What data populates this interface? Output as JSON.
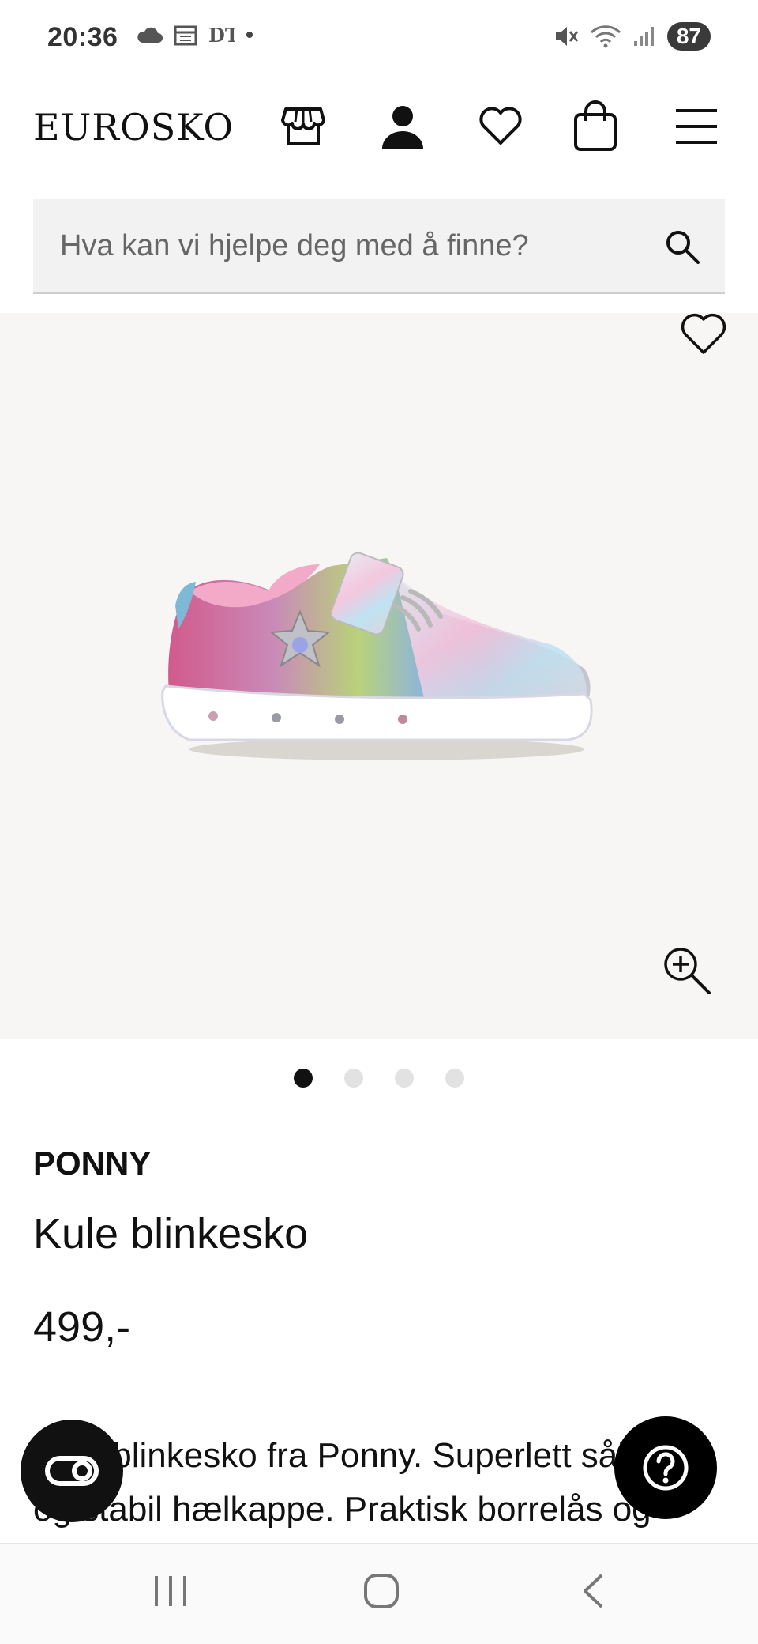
{
  "status": {
    "time": "20:36",
    "battery": "87"
  },
  "header": {
    "logo": "EUROSKO",
    "icons": [
      "store-icon",
      "account-icon",
      "wishlist-icon",
      "cart-icon",
      "menu-icon"
    ]
  },
  "search": {
    "placeholder": "Hva kan vi hjelpe deg med å finne?"
  },
  "gallery": {
    "slide_count": 4,
    "active_index": 0
  },
  "product": {
    "brand": "PONNY",
    "name": "Kule blinkesko",
    "price": "499,-",
    "description": "Kule blinkesko fra Ponny. Superlett såle og stabil hælkappe. Praktisk borrelås og"
  },
  "colors": {
    "accent": "#111111",
    "image_bg": "#f7f6f4",
    "search_bg": "#f2f2f2"
  }
}
